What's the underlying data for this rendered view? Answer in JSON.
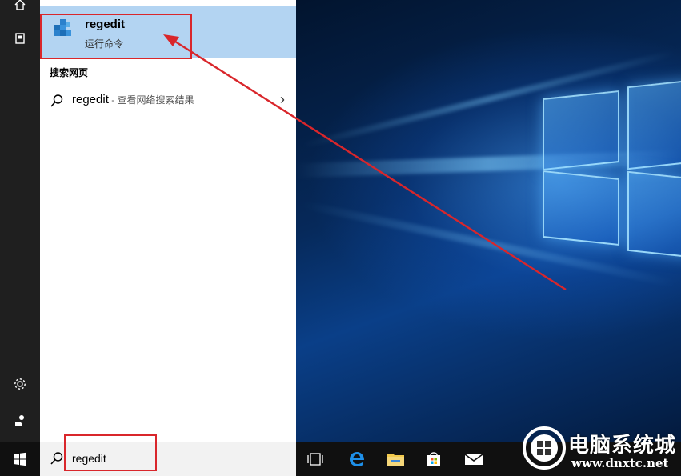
{
  "search_panel": {
    "top_result": {
      "title": "regedit",
      "subtitle": "运行命令",
      "icon": "regedit-icon"
    },
    "web_section_header": "搜索网页",
    "web_result": {
      "query": "regedit",
      "hint": " - 查看网络搜索结果"
    }
  },
  "rail": {
    "items": [
      {
        "icon": "home-icon"
      },
      {
        "icon": "notebook-icon"
      },
      {
        "icon": "settings-icon"
      },
      {
        "icon": "feedback-icon"
      }
    ]
  },
  "taskbar": {
    "search_value": "regedit",
    "icons": [
      "task-view-icon",
      "edge-icon",
      "file-explorer-icon",
      "store-icon",
      "mail-icon"
    ]
  },
  "annotation": {
    "color": "#d9262b"
  },
  "watermark": {
    "brand": "电脑系统城",
    "url": "www.dnxtc.net"
  },
  "colors": {
    "highlight": "#b3d4f2",
    "taskbar": "#101010",
    "rail": "#1f1f1f"
  }
}
